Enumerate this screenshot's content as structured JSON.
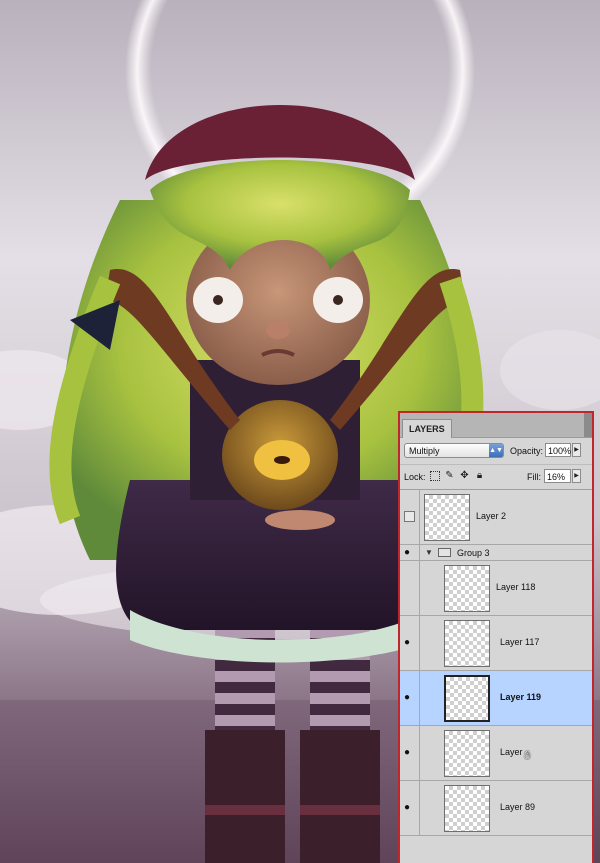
{
  "panel": {
    "tab_label": "LAYERS",
    "blend_mode": "Multiply",
    "opacity_label": "Opacity:",
    "opacity_value": "100%",
    "lock_label": "Lock:",
    "fill_label": "Fill:",
    "fill_value": "16%"
  },
  "layers": [
    {
      "name": "Layer 2",
      "visible": false,
      "type": "layer"
    },
    {
      "name": "Group 3",
      "visible": true,
      "type": "group",
      "expanded": true
    },
    {
      "name": "Layer 118",
      "visible": false,
      "type": "layer"
    },
    {
      "name": "Layer 117",
      "visible": true,
      "type": "layer"
    },
    {
      "name": "Layer 119",
      "visible": true,
      "type": "layer",
      "selected": true
    },
    {
      "name": "Layer",
      "visible": true,
      "type": "layer"
    },
    {
      "name": "Layer 89",
      "visible": true,
      "type": "layer"
    }
  ],
  "colors": {
    "panel_border": "#c0262b",
    "selection": "#b7d3ff",
    "hair": "#9cba3a",
    "dress": "#2f1f35",
    "sky": "#d8d2d9"
  },
  "icons": [
    "eye-icon",
    "folder-icon",
    "disclosure-triangle-icon",
    "lock-icon",
    "move-icon",
    "brush-icon",
    "transparency-lock-icon",
    "pointer-cursor-icon"
  ]
}
